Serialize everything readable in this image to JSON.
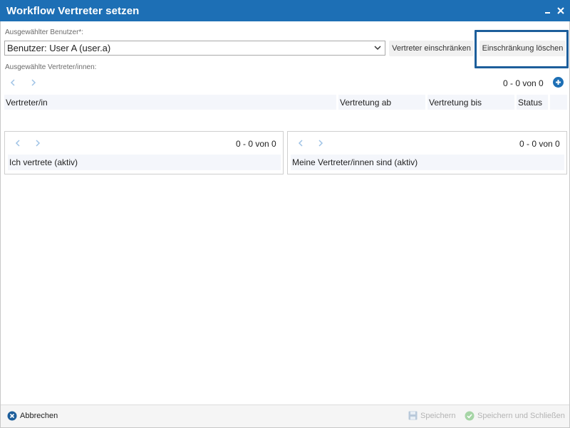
{
  "window": {
    "title": "Workflow Vertreter setzen"
  },
  "user_field": {
    "label": "Ausgewählter Benutzer*:",
    "value": "Benutzer: User A (user.a)"
  },
  "buttons": {
    "restrict": "Vertreter einschränken",
    "clear_restriction": "Einschränkung löschen"
  },
  "substitutes": {
    "label": "Ausgewählte Vertreter/innen:",
    "count": "0 - 0 von 0",
    "columns": [
      "Vertreter/in",
      "Vertretung ab",
      "Vertretung bis",
      "Status"
    ]
  },
  "panel_left": {
    "count": "0 - 0 von 0",
    "header": "Ich vertrete (aktiv)"
  },
  "panel_right": {
    "count": "0 - 0 von 0",
    "header": "Meine Vertreter/innen sind (aktiv)"
  },
  "footer": {
    "cancel": "Abbrechen",
    "save": "Speichern",
    "save_close": "Speichern und Schließen"
  },
  "colors": {
    "accent": "#1d6fb5",
    "disabled": "#b4b4b4",
    "cancel_icon": "#1d5e9b"
  }
}
